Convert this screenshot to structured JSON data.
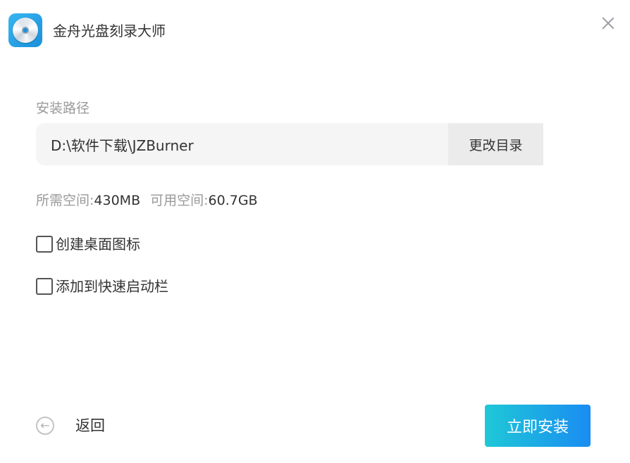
{
  "window": {
    "title": "金舟光盘刻录大师",
    "logo_icon": "disc-icon",
    "close_icon": "close-icon"
  },
  "install": {
    "section_label": "安装路径",
    "path_value": "D:\\软件下载\\JZBurner",
    "change_dir_label": "更改目录"
  },
  "space": {
    "required_label": "所需空间:",
    "required_value": "430MB",
    "available_label": "可用空间:",
    "available_value": "60.7GB"
  },
  "options": [
    {
      "label": "创建桌面图标",
      "checked": false
    },
    {
      "label": "添加到快速启动栏",
      "checked": false
    }
  ],
  "footer": {
    "back_label": "返回",
    "back_icon": "back-arrow-icon",
    "install_label": "立即安装"
  },
  "colors": {
    "accent_start": "#1fc8d7",
    "accent_end": "#1a8cf2",
    "muted_text": "#999999",
    "input_bg": "#f5f5f5"
  }
}
